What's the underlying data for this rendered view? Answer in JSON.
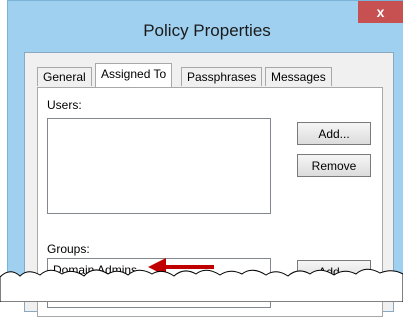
{
  "window": {
    "title": "Policy Properties",
    "close_label": "x"
  },
  "tabs": [
    {
      "label": "General"
    },
    {
      "label": "Assigned To"
    },
    {
      "label": "Passphrases"
    },
    {
      "label": "Messages"
    }
  ],
  "users": {
    "label": "Users:",
    "add_label": "Add...",
    "remove_label": "Remove",
    "items": []
  },
  "groups": {
    "label": "Groups:",
    "add_label": "Add...",
    "items": [
      "Domain Admins"
    ]
  },
  "colors": {
    "title_bar": "#9fd0f0",
    "close_button": "#c75050",
    "arrow": "#c00000"
  }
}
